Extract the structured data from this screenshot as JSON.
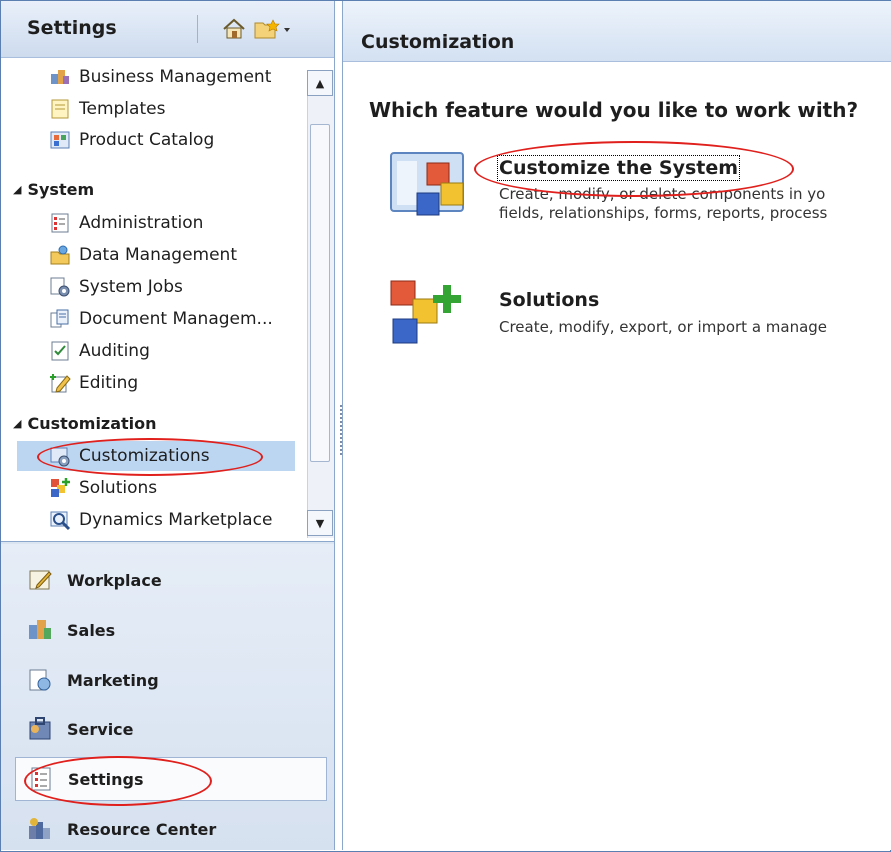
{
  "nav": {
    "title": "Settings",
    "home_icon": "home-icon",
    "favorites_icon": "favorites-folder-icon",
    "tree": {
      "items_top": [
        {
          "label": "Business Management",
          "icon": "business-management-icon"
        },
        {
          "label": "Templates",
          "icon": "templates-icon"
        },
        {
          "label": "Product Catalog",
          "icon": "product-catalog-icon"
        }
      ],
      "group_system": "System",
      "system_items": [
        {
          "label": "Administration",
          "icon": "administration-icon"
        },
        {
          "label": "Data Management",
          "icon": "data-management-icon"
        },
        {
          "label": "System Jobs",
          "icon": "system-jobs-icon"
        },
        {
          "label": "Document Managem...",
          "icon": "document-management-icon"
        },
        {
          "label": "Auditing",
          "icon": "auditing-icon"
        },
        {
          "label": "Editing",
          "icon": "editing-icon"
        }
      ],
      "group_customization": "Customization",
      "customization_items": [
        {
          "label": "Customizations",
          "icon": "customizations-icon",
          "selected": true
        },
        {
          "label": "Solutions",
          "icon": "solutions-icon"
        },
        {
          "label": "Dynamics Marketplace",
          "icon": "dynamics-marketplace-icon"
        }
      ]
    },
    "wunderbar": [
      {
        "label": "Workplace",
        "icon": "workplace-icon"
      },
      {
        "label": "Sales",
        "icon": "sales-icon"
      },
      {
        "label": "Marketing",
        "icon": "marketing-icon"
      },
      {
        "label": "Service",
        "icon": "service-icon"
      },
      {
        "label": "Settings",
        "icon": "settings-icon",
        "active": true
      },
      {
        "label": "Resource Center",
        "icon": "resource-center-icon"
      }
    ]
  },
  "content": {
    "title": "Customization",
    "question": "Which feature would you like to work with?",
    "features": [
      {
        "title": "Customize the System",
        "desc1": "Create, modify, or delete components in yo",
        "desc2": "fields, relationships, forms, reports, process",
        "icon": "customize-system-icon"
      },
      {
        "title": "Solutions",
        "desc1": "Create, modify, export, or import a manage",
        "icon": "solutions-feature-icon"
      }
    ]
  },
  "annotation_color": "#e0201c"
}
